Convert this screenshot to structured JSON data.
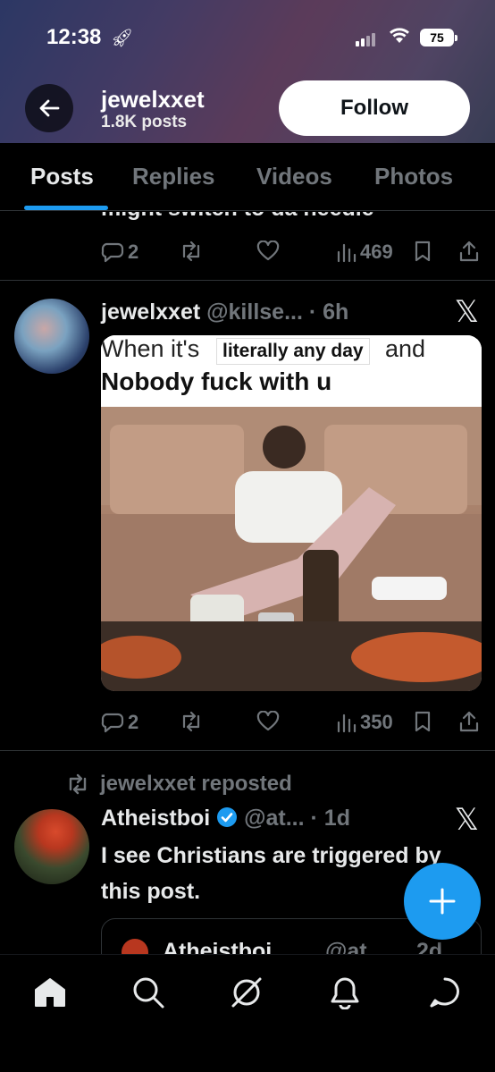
{
  "status_bar": {
    "time": "12:38",
    "battery": "75"
  },
  "profile": {
    "name": "jewelxxet",
    "posts": "1.8K posts",
    "follow_label": "Follow"
  },
  "tabs": [
    {
      "label": "Posts",
      "active": true
    },
    {
      "label": "Replies",
      "active": false
    },
    {
      "label": "Videos",
      "active": false
    },
    {
      "label": "Photos",
      "active": false
    }
  ],
  "feed": {
    "cut_post": {
      "text": "might switch to da needle",
      "replies": "2",
      "views": "469"
    },
    "post1": {
      "name": "jewelxxet",
      "handle": "@killse...",
      "time": "· 6h",
      "meme_line1": "When it's",
      "meme_box": "literally any day",
      "meme_line1_end": "and",
      "meme_line2": "Nobody fuck with u",
      "replies": "2",
      "views": "350"
    },
    "post2": {
      "repost_label": "jewelxxet reposted",
      "name": "Atheistboi",
      "handle": "@at...",
      "time": "· 1d",
      "text": "I see Christians are triggered by this post.",
      "quote_name": "Atheistboi",
      "quote_handle": "@at...",
      "quote_time": "2d"
    }
  },
  "colors": {
    "accent": "#1d9bf0",
    "muted": "#71767b",
    "background": "#000000"
  }
}
